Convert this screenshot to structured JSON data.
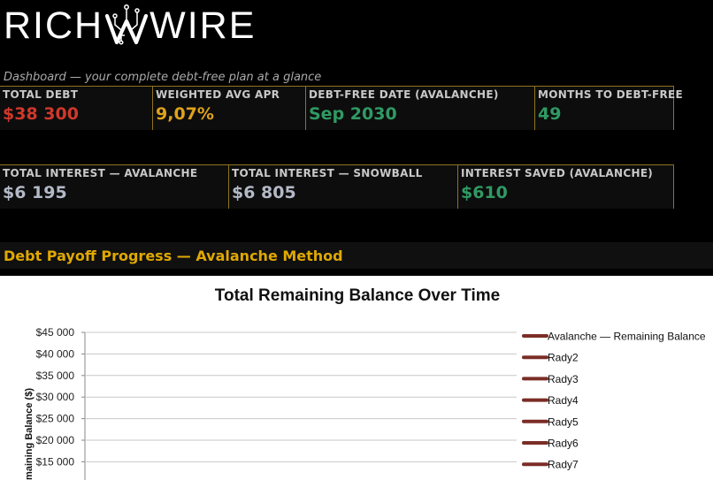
{
  "header": {
    "logo_text_left": "RICH",
    "logo_text_right": "WIRE",
    "tagline": "Dashboard — your complete debt-free plan at a glance"
  },
  "kpis_row1": [
    {
      "label": "TOTAL DEBT",
      "value": "$38 300",
      "color": "#d0382b"
    },
    {
      "label": "WEIGHTED AVG APR",
      "value": "9,07%",
      "color": "#e0a21c"
    },
    {
      "label": "DEBT-FREE DATE (AVALANCHE)",
      "value": "Sep 2030",
      "color": "#2f9a63"
    },
    {
      "label": "MONTHS TO DEBT-FREE",
      "value": "49",
      "color": "#2f9a63"
    }
  ],
  "kpis_row2": [
    {
      "label": "TOTAL INTEREST — AVALANCHE",
      "value": "$6 195",
      "color": "#b3b9c6"
    },
    {
      "label": "TOTAL INTEREST — SNOWBALL",
      "value": "$6 805",
      "color": "#b3b9c6"
    },
    {
      "label": "INTEREST SAVED (AVALANCHE)",
      "value": "$610",
      "color": "#2f9a63"
    }
  ],
  "section": {
    "title": "Debt Payoff Progress — Avalanche Method",
    "color": "#e0a800"
  },
  "chart_data": {
    "type": "line",
    "title": "Total Remaining Balance Over Time",
    "xlabel": "",
    "ylabel": "Remaining Balance ($)",
    "ylim": [
      15000,
      45000
    ],
    "y_ticks": [
      "$45 000",
      "$40 000",
      "$35 000",
      "$30 000",
      "$25 000",
      "$20 000",
      "$15 000"
    ],
    "y_tick_values": [
      45000,
      40000,
      35000,
      30000,
      25000,
      20000,
      15000
    ],
    "grid": true,
    "legend_position": "right",
    "series_color": "#7b2d26",
    "series": [
      {
        "name": "Avalanche — Remaining Balance",
        "values": []
      },
      {
        "name": "Rady2",
        "values": []
      },
      {
        "name": "Rady3",
        "values": []
      },
      {
        "name": "Rady4",
        "values": []
      },
      {
        "name": "Rady5",
        "values": []
      },
      {
        "name": "Rady6",
        "values": []
      },
      {
        "name": "Rady7",
        "values": []
      }
    ]
  }
}
